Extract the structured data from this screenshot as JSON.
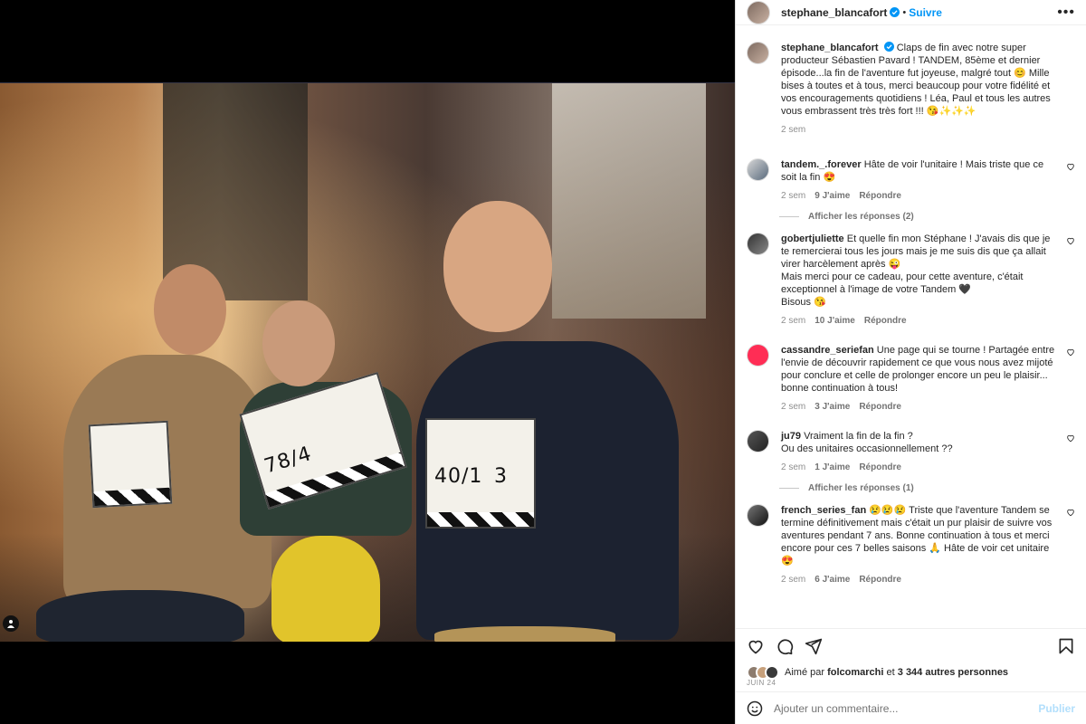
{
  "header": {
    "username": "stephane_blancafort",
    "follow_label": "Suivre",
    "more_label": "•••"
  },
  "post": {
    "clapper_numbers": [
      "78/4",
      "40/1",
      "3"
    ]
  },
  "caption": {
    "username": "stephane_blancafort",
    "text": "Claps de fin avec notre super producteur Sébastien Pavard ! TANDEM, 85ème et dernier épisode...la fin de l'aventure fut joyeuse, malgré tout 😊 Mille bises à toutes et à tous, merci beaucoup pour votre fidélité et vos encouragements quotidiens ! Léa, Paul et tous les autres vous embrassent très très fort !!! 😘✨✨✨",
    "time": "2 sem"
  },
  "comments": [
    {
      "username": "tandem._.forever",
      "text": "Hâte de voir l'unitaire ! Mais triste que ce soit la fin 😍",
      "time": "2 sem",
      "likes": "9 J'aime",
      "reply_label": "Répondre",
      "replies_label": "Afficher les réponses (2)"
    },
    {
      "username": "gobertjuliette",
      "text": "Et quelle fin mon Stéphane ! J'avais dis que je te remercierai tous les jours mais je me suis dis que ça allait virer harcèlement après 😜",
      "text2": "Mais merci pour ce cadeau, pour cette aventure, c'était exceptionnel à l'image de votre Tandem 🖤",
      "text3": "Bisous 😘",
      "time": "2 sem",
      "likes": "10 J'aime",
      "reply_label": "Répondre"
    },
    {
      "username": "cassandre_seriefan",
      "text": "Une page qui se tourne ! Partagée entre l'envie de découvrir rapidement ce que vous nous avez mijoté pour conclure et celle de prolonger encore un peu le plaisir... bonne continuation à tous!",
      "time": "2 sem",
      "likes": "3 J'aime",
      "reply_label": "Répondre"
    },
    {
      "username": "ju79",
      "text": "Vraiment la fin de la fin ?",
      "text2": "Ou des unitaires occasionnellement ??",
      "time": "2 sem",
      "likes": "1 J'aime",
      "reply_label": "Répondre",
      "replies_label": "Afficher les réponses (1)"
    },
    {
      "username": "french_series_fan",
      "text": "😢😢😢 Triste que l'aventure Tandem se termine définitivement mais c'était un pur plaisir de suivre vos aventures pendant 7 ans. Bonne continuation à tous et merci encore pour ces 7 belles saisons 🙏 Hâte de voir cet unitaire 😍",
      "time": "2 sem",
      "likes": "6 J'aime",
      "reply_label": "Répondre"
    }
  ],
  "liked_by": {
    "prefix": "Aimé par",
    "user": "folcomarchi",
    "connector": "et",
    "others": "3 344 autres personnes"
  },
  "post_date": "JUIN 24",
  "add_comment": {
    "placeholder": "Ajouter un commentaire...",
    "publish_label": "Publier"
  },
  "colors": {
    "accent": "#0095f6",
    "publish_disabled": "#b2dffc",
    "muted": "#8e8e8e"
  },
  "icons": [
    "verified-icon",
    "more-icon",
    "heart-icon",
    "comment-icon",
    "share-icon",
    "bookmark-icon",
    "emoji-icon",
    "user-tag-icon"
  ]
}
